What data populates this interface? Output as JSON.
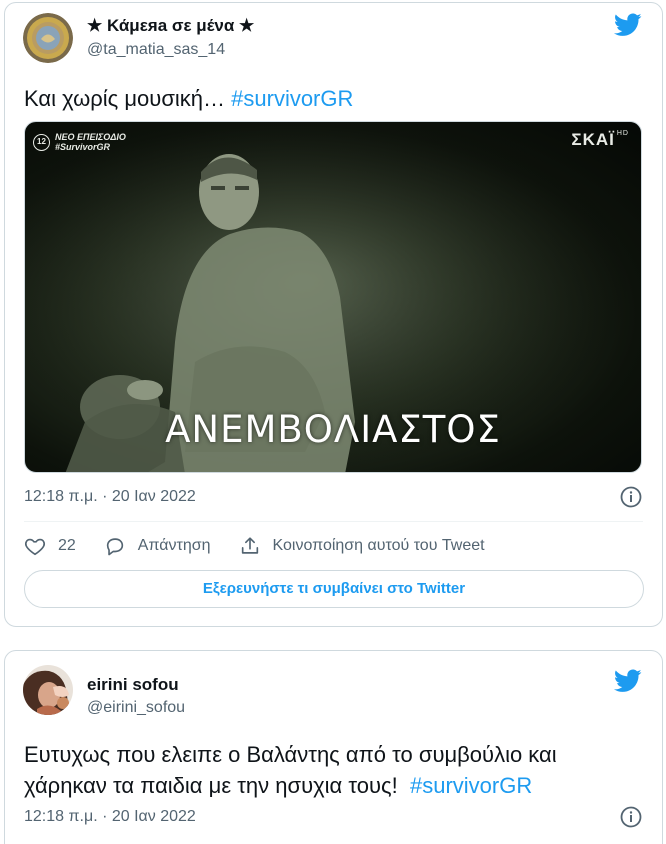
{
  "tweet1": {
    "display_name": "★ Κάμεяа σε μένα ★",
    "handle": "@ta_matia_sas_14",
    "text": "Και χωρίς μουσική… ",
    "hashtag": "#survivorGR",
    "media": {
      "caption": "ΑΝΕΜΒΟΛΙΑΣΤΟΣ",
      "channel_logo": "ΣΚΑΪ",
      "channel_badge": "HD",
      "rating_badge": "12",
      "overlay_line1": "ΝΕΟ ΕΠΕΙΣΟΔΙΟ",
      "overlay_line2": "#SurvivorGR"
    },
    "timestamp": "12:18 π.μ. · 20 Ιαν 2022",
    "likes": "22",
    "reply_label": "Απάντηση",
    "share_label": "Κοινοποίηση αυτού του Tweet",
    "explore_label": "Εξερευνήστε τι συμβαίνει στο Twitter"
  },
  "tweet2": {
    "display_name": "eirini sofou",
    "handle": "@eirini_sofou",
    "text_line1": "Ευτυχως που ελειπε ο Βαλάντης από το συμβούλιο και",
    "text_line2": "χάρηκαν τα παιδια με την ησυχια τους!  ",
    "hashtag": "#survivorGR",
    "timestamp": "12:18 π.μ. · 20 Ιαν 2022"
  },
  "colors": {
    "accent": "#1d9bf0",
    "text_primary": "#0f1419",
    "text_secondary": "#536471",
    "border": "#cfd9de"
  },
  "icons": {
    "bird": "twitter-bird-icon",
    "info": "info-icon",
    "like": "heart-icon",
    "reply": "reply-bubble-icon",
    "share": "share-upload-icon"
  }
}
